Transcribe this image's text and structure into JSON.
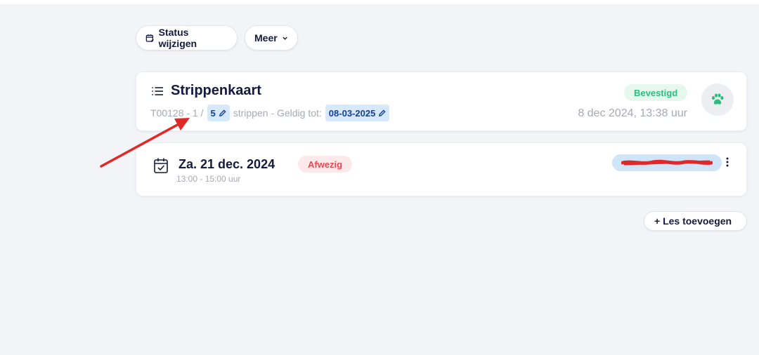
{
  "toolbar": {
    "status_label": "Status wijzigen",
    "more_label": "Meer"
  },
  "pass_card": {
    "title": "Strippenkaart",
    "code": "T00128 - 1 /",
    "strips": "5",
    "strips_suffix": "strippen - Geldig tot:",
    "valid_until": "08-03-2025",
    "status": "Bevestigd",
    "created": "8 dec 2024, 13:38 uur"
  },
  "lesson_card": {
    "date": "Za. 21 dec. 2024",
    "time": "13:00 - 15:00 uur",
    "status": "Afwezig"
  },
  "add_lesson_label": "+ Les toevoegen",
  "colors": {
    "accent": "#173f92",
    "success": "#2bbd7e",
    "danger": "#e5484d",
    "annotation_arrow": "#e02828"
  },
  "icons": {
    "status": "calendar-edit-icon",
    "more": "chevron-down-icon",
    "pass": "list-icon",
    "edit": "pencil-icon",
    "avatar": "paw-icon",
    "lesson": "calendar-check-icon",
    "menu": "kebab-menu-icon"
  }
}
